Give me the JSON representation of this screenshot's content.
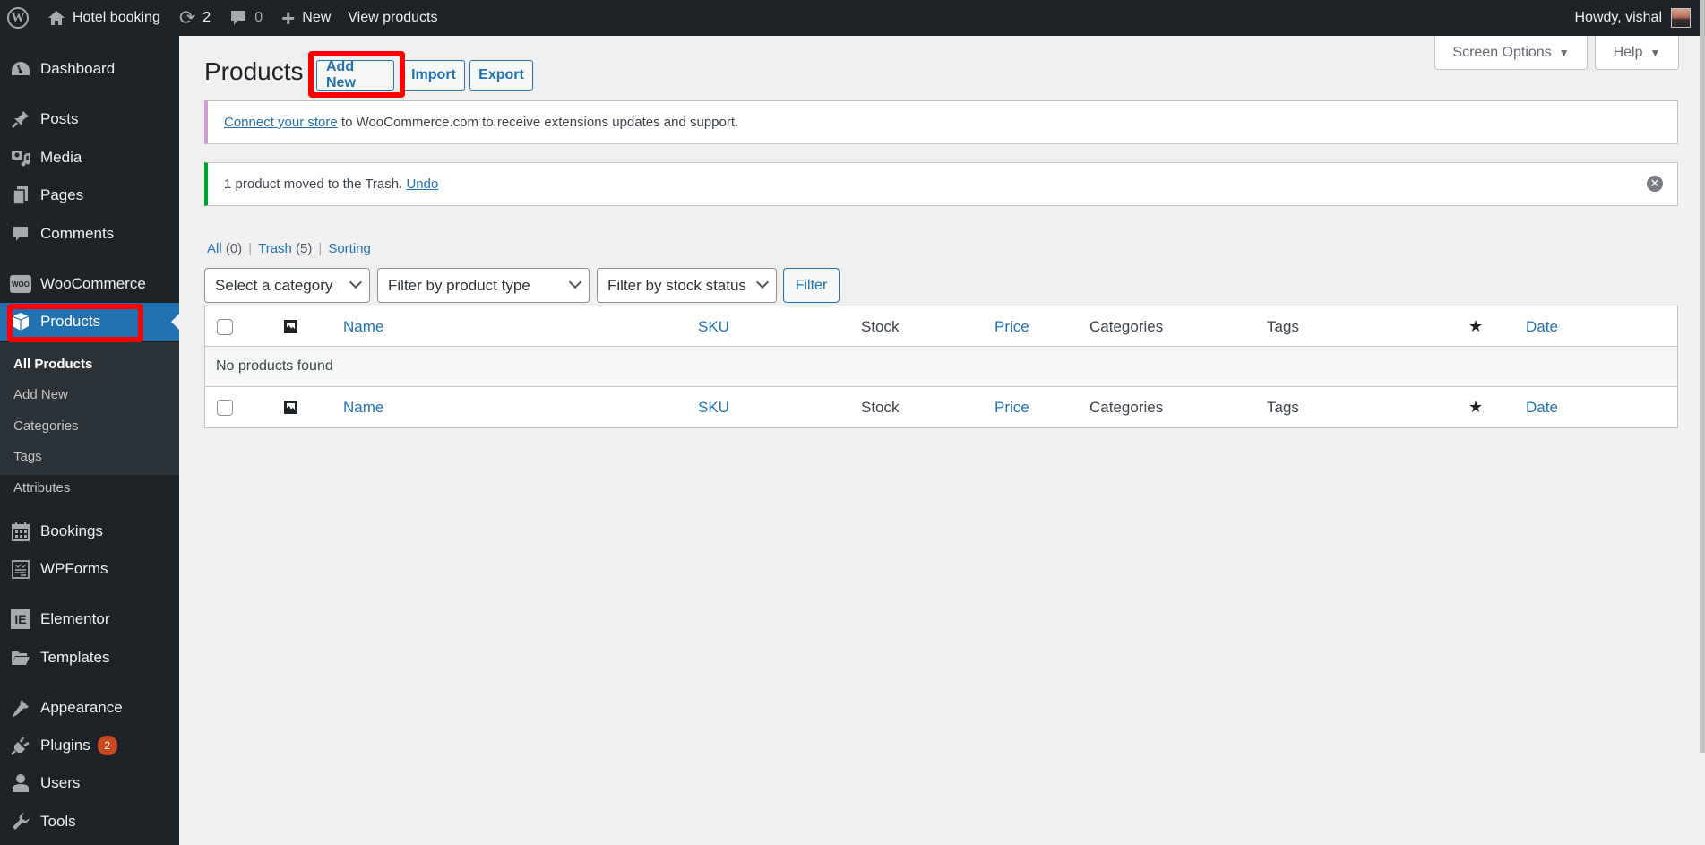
{
  "adminbar": {
    "site_name": "Hotel booking",
    "updates_count": "2",
    "comments_count": "0",
    "new_label": "New",
    "view_label": "View products",
    "howdy": "Howdy, vishal"
  },
  "sidebar": {
    "items": [
      {
        "label": "Dashboard",
        "icon": "dashboard-icon"
      },
      {
        "label": "Posts",
        "icon": "pin-icon"
      },
      {
        "label": "Media",
        "icon": "media-icon"
      },
      {
        "label": "Pages",
        "icon": "pages-icon"
      },
      {
        "label": "Comments",
        "icon": "comment-icon"
      },
      {
        "label": "WooCommerce",
        "icon": "woo-icon"
      },
      {
        "label": "Products",
        "icon": "box-icon",
        "current": true
      },
      {
        "label": "Bookings",
        "icon": "calendar-icon"
      },
      {
        "label": "WPForms",
        "icon": "form-icon"
      },
      {
        "label": "Elementor",
        "icon": "elementor-icon"
      },
      {
        "label": "Templates",
        "icon": "folder-icon"
      },
      {
        "label": "Appearance",
        "icon": "brush-icon"
      },
      {
        "label": "Plugins",
        "icon": "plug-icon",
        "badge": "2"
      },
      {
        "label": "Users",
        "icon": "user-icon"
      },
      {
        "label": "Tools",
        "icon": "wrench-icon"
      }
    ],
    "submenu": [
      "All Products",
      "Add New",
      "Categories",
      "Tags",
      "Attributes"
    ]
  },
  "header": {
    "title": "Products",
    "add_new": "Add New",
    "import": "Import",
    "export": "Export",
    "screen_options": "Screen Options",
    "help": "Help"
  },
  "notices": {
    "connect_link": "Connect your store",
    "connect_text": " to WooCommerce.com to receive extensions updates and support.",
    "trash_text": "1 product moved to the Trash. ",
    "undo": "Undo"
  },
  "views": {
    "all": "All",
    "all_count": "(0)",
    "trash": "Trash",
    "trash_count": "(5)",
    "sorting": "Sorting"
  },
  "filters": {
    "category": "Select a category",
    "product_type": "Filter by product type",
    "stock_status": "Filter by stock status",
    "button": "Filter"
  },
  "table": {
    "columns": {
      "name": "Name",
      "sku": "SKU",
      "stock": "Stock",
      "price": "Price",
      "categories": "Categories",
      "tags": "Tags",
      "featured": "★",
      "date": "Date"
    },
    "empty": "No products found"
  },
  "colors": {
    "accent": "#2271b1",
    "adminbar": "#1d2327",
    "highlight": "#ff0000",
    "success": "#00a32a",
    "woo_notice": "#c9a0c9"
  }
}
